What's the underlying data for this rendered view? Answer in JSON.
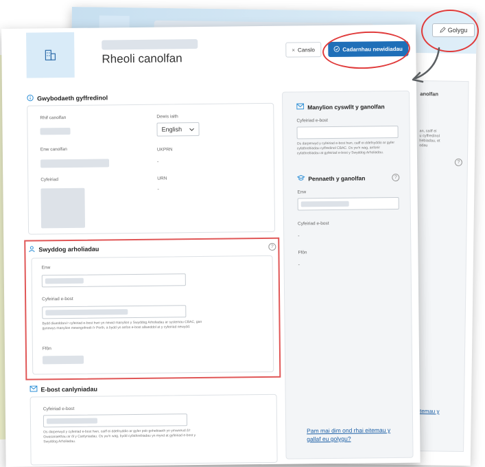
{
  "back_window": {
    "edit_label": "Golygu",
    "panel_heading_fragment": "anolfan",
    "panel_text_fragment": "an, caiff ei\nu cyffredinol\nhebiadau, et\nodau",
    "link_fragment": "eitemau y"
  },
  "header": {
    "title": "Rheoli canolfan",
    "cancel_label": "Canslo",
    "confirm_label": "Cadarnhau newidiadau"
  },
  "general": {
    "heading": "Gwybodaeth gyffredinol",
    "centre_number_label": "Rhif canolfan",
    "language_label": "Dewis iaith",
    "language_value": "English",
    "centre_name_label": "Enw canolfan",
    "ukprn_label": "UKPRN",
    "ukprn_value": "-",
    "address_label": "Cyfeiriad",
    "urn_label": "URN",
    "urn_value": "-"
  },
  "exam_officer": {
    "heading": "Swyddog arholiadau",
    "name_label": "Enw",
    "email_label": "Cyfeiriad e-bost",
    "email_help": "Bydd diweddaru'r cyfeiriad e-bost hwn yn newid manylion y Swyddog Arholiadau ar systemau CBAC, gan gynnwys manylion mewngofnodi i'r Porth, a bydd yn anfon e-bost allweddol at y cyfeiriad newydd.",
    "phone_label": "Ffôn"
  },
  "results_email": {
    "heading": "E-bost canlyniadau",
    "email_label": "Cyfeiriad e-bost",
    "email_help": "Os darperwyd y cyfeiriad e-bost hwn, caiff ei ddefnyddio ar gyfer pob gohebiaeth yn ymwneud â'r Gwasanaethau ar ôl y Canlyniadau. Os yw'n wag, bydd cyfathrebiadau yn mynd at gyfeiriad e-bost y Swyddog Arholiadau."
  },
  "side": {
    "contact_heading": "Manylion cyswllt y ganolfan",
    "email_label": "Cyfeiriad e-bost",
    "contact_help": "Os darperwyd y cyfeiriad e-bost hwn, caiff ei ddefnyddio ar gyfer cyfathrebiadau cyffredinol CBAC. Os yw'n wag, anfonir cyfathrebiadau at gyfeiriad e-bost y Swyddog Arholiadau.",
    "head_heading": "Pennaeth y ganolfan",
    "name_label": "Enw",
    "head_email_label": "Cyfeiriad e-bost",
    "head_email_value": "-",
    "phone_label": "Ffôn",
    "phone_value": "-",
    "link_text": "Pam mai dim ond rhai eitemau y gallaf eu golygu?"
  },
  "colors": {
    "accent": "#1f6fb8",
    "highlight_red": "#e03a3a",
    "side_panel_bg": "#f3f5f7"
  }
}
